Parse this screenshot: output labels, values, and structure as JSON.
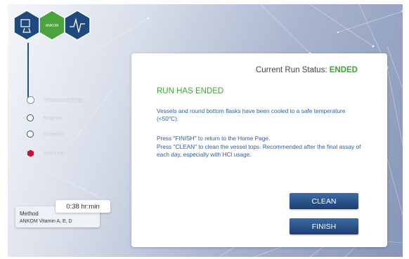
{
  "logo": {
    "brand": "ANKOM",
    "icons": [
      "flask-icon",
      "ankom-logo",
      "waveform-icon"
    ]
  },
  "sidebar": {
    "items": [
      {
        "label": "Temperature Graph",
        "icon": "radio-icon"
      },
      {
        "label": "Progress",
        "icon": "radio-icon"
      },
      {
        "label": "Schematic",
        "icon": "radio-icon"
      },
      {
        "label": "Abort Run",
        "icon": "abort-hex-icon"
      }
    ]
  },
  "method": {
    "label": "Method",
    "name": "ANKOM Vitamin A, E, D",
    "time": "0:38 hr:min"
  },
  "status": {
    "label": "Current Run Status:",
    "value": "ENDED"
  },
  "panel": {
    "heading": "RUN HAS ENDED",
    "line1": "Vessels and round bottom flasks have been cooled to a safe temperature (<50°C).",
    "line2": "Press \"FINISH\" to return to the Home Page.",
    "line3": "Press \"CLEAN\" to clean the vessel tops. Recommended after the final assay of each day, especially with HCl usage."
  },
  "buttons": {
    "clean": "CLEAN",
    "finish": "FINISH"
  },
  "colors": {
    "accent_green": "#3fa535",
    "navy": "#1e3f75",
    "text_blue": "#2f5f9a",
    "abort_red": "#c8102e"
  }
}
